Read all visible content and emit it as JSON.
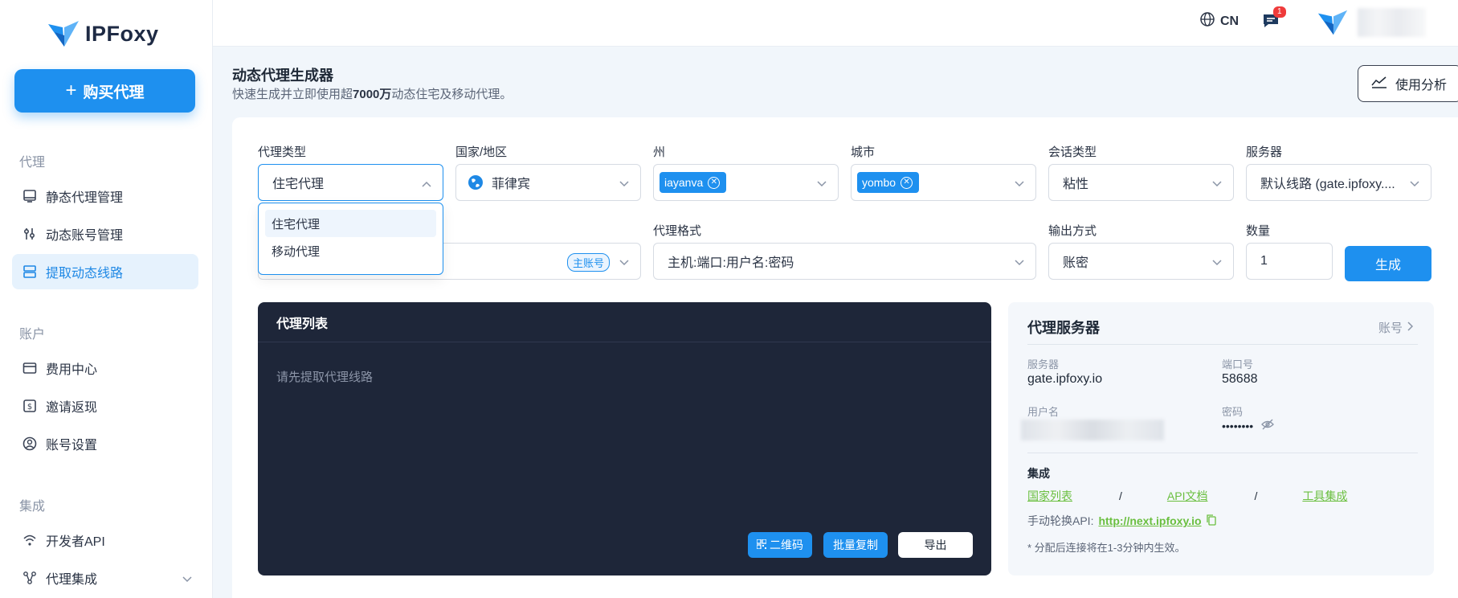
{
  "brand": {
    "name": "IPFoxy"
  },
  "sidebar": {
    "buy_label": "购买代理",
    "sections": [
      {
        "title": "代理"
      },
      {
        "title": "账户"
      },
      {
        "title": "集成"
      }
    ],
    "items": [
      {
        "label": "静态代理管理"
      },
      {
        "label": "动态账号管理"
      },
      {
        "label": "提取动态线路"
      },
      {
        "label": "费用中心"
      },
      {
        "label": "邀请返现"
      },
      {
        "label": "账号设置"
      },
      {
        "label": "开发者API"
      },
      {
        "label": "代理集成"
      }
    ]
  },
  "topbar": {
    "lang": "CN",
    "msg_count": "1"
  },
  "page": {
    "title": "动态代理生成器",
    "subtitle_pre": "快速生成并立即使用超",
    "subtitle_bold": "7000万",
    "subtitle_post": "动态住宅及移动代理。",
    "usage_label": "使用分析"
  },
  "form": {
    "proxy_type": {
      "label": "代理类型",
      "value": "住宅代理",
      "options": [
        "住宅代理",
        "移动代理"
      ]
    },
    "country": {
      "label": "国家/地区",
      "value": "菲律宾"
    },
    "state": {
      "label": "州",
      "chip": "iayanva"
    },
    "city": {
      "label": "城市",
      "chip": "yombo"
    },
    "session": {
      "label": "会话类型",
      "value": "粘性"
    },
    "server": {
      "label": "服务器",
      "value": "默认线路 (gate.ipfoxy...."
    },
    "account_tag": "主账号",
    "format": {
      "label": "代理格式",
      "value": "主机:端口:用户名:密码"
    },
    "output": {
      "label": "输出方式",
      "value": "账密"
    },
    "quantity": {
      "label": "数量",
      "value": "1"
    },
    "generate_label": "生成"
  },
  "proxy_list": {
    "title": "代理列表",
    "empty": "请先提取代理线路",
    "qr_label": "二维码",
    "copy_label": "批量复制",
    "export_label": "导出"
  },
  "proxy_server": {
    "title": "代理服务器",
    "account_link": "账号",
    "server_label": "服务器",
    "server_value": "gate.ipfoxy.io",
    "port_label": "端口号",
    "port_value": "58688",
    "user_label": "用户名",
    "pass_label": "密码",
    "pass_value": "••••••••",
    "integration_title": "集成",
    "links": [
      "国家列表",
      "API文档",
      "工具集成"
    ],
    "separator": "/",
    "api_label": "手动轮换API:",
    "api_url": "http://next.ipfoxy.io",
    "note": "* 分配后连接将在1-3分钟内生效。"
  },
  "colors": {
    "primary": "#1e90ef",
    "dark_panel": "#1e2639",
    "link_green": "#6abf3f"
  }
}
